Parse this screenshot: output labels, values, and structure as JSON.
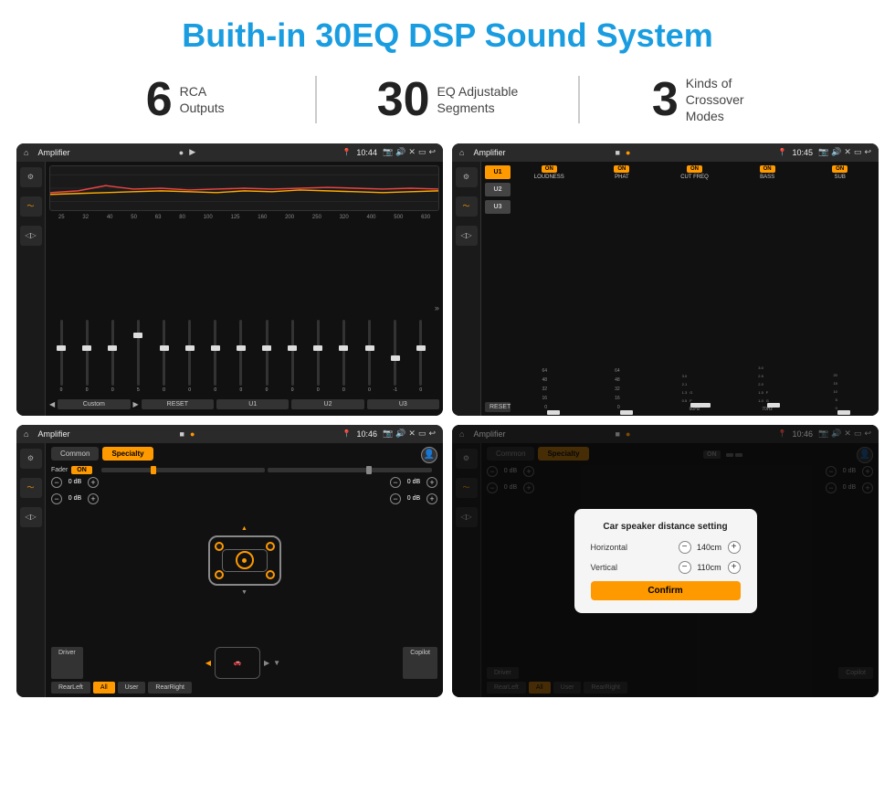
{
  "page": {
    "title": "Buith-in 30EQ DSP Sound System",
    "stats": [
      {
        "number": "6",
        "label": "RCA\nOutputs"
      },
      {
        "number": "30",
        "label": "EQ Adjustable\nSegments"
      },
      {
        "number": "3",
        "label": "Kinds of\nCrossover Modes"
      }
    ]
  },
  "screens": {
    "eq": {
      "status_bar": {
        "home": "⌂",
        "title": "Amplifier",
        "dot1": "●",
        "dot2": "▶",
        "time": "10:44",
        "app_title": "Amplifier"
      },
      "freq_labels": [
        "25",
        "32",
        "40",
        "50",
        "63",
        "80",
        "100",
        "125",
        "160",
        "200",
        "250",
        "320",
        "400",
        "500",
        "630"
      ],
      "eq_values": [
        "0",
        "0",
        "0",
        "5",
        "0",
        "0",
        "0",
        "0",
        "0",
        "0",
        "0",
        "0",
        "0",
        "-1",
        "0",
        "-1"
      ],
      "buttons": [
        "Custom",
        "RESET",
        "U1",
        "U2",
        "U3"
      ],
      "sidebar_icons": [
        "⚙",
        "〜",
        "◁▷"
      ]
    },
    "crossover": {
      "status_bar": {
        "title": "Amplifier",
        "time": "10:45"
      },
      "presets": [
        "U1",
        "U2",
        "U3"
      ],
      "channels": [
        {
          "toggle": "ON",
          "label": "LOUDNESS"
        },
        {
          "toggle": "ON",
          "label": "PHAT"
        },
        {
          "toggle": "ON",
          "label": "CUT FREQ"
        },
        {
          "toggle": "ON",
          "label": "BASS"
        },
        {
          "toggle": "ON",
          "label": "SUB"
        }
      ],
      "reset_btn": "RESET",
      "sidebar_icons": [
        "⚙",
        "〜",
        "◁▷"
      ]
    },
    "fader": {
      "status_bar": {
        "title": "Amplifier",
        "time": "10:46"
      },
      "tabs": [
        "Common",
        "Specialty"
      ],
      "fader_label": "Fader",
      "toggle_label": "ON",
      "db_left_top": "0 dB",
      "db_left_bot": "0 dB",
      "db_right_top": "0 dB",
      "db_right_bot": "0 dB",
      "bottom_labels": [
        "Driver",
        "Copilot",
        "RearLeft",
        "All",
        "User",
        "RearRight"
      ],
      "sidebar_icons": [
        "⚙",
        "〜",
        "◁▷"
      ]
    },
    "dialog": {
      "status_bar": {
        "title": "Amplifier",
        "time": "10:46"
      },
      "tabs": [
        "Common",
        "Specialty"
      ],
      "dialog": {
        "title": "Car speaker distance setting",
        "horizontal_label": "Horizontal",
        "horizontal_value": "140cm",
        "vertical_label": "Vertical",
        "vertical_value": "110cm",
        "confirm_label": "Confirm"
      },
      "db_right_top": "0 dB",
      "db_right_bot": "0 dB",
      "bottom_labels": [
        "Driver",
        "Copilot",
        "RearLeft",
        "All",
        "User",
        "RearRight"
      ],
      "sidebar_icons": [
        "⚙",
        "〜",
        "◁▷"
      ]
    }
  }
}
